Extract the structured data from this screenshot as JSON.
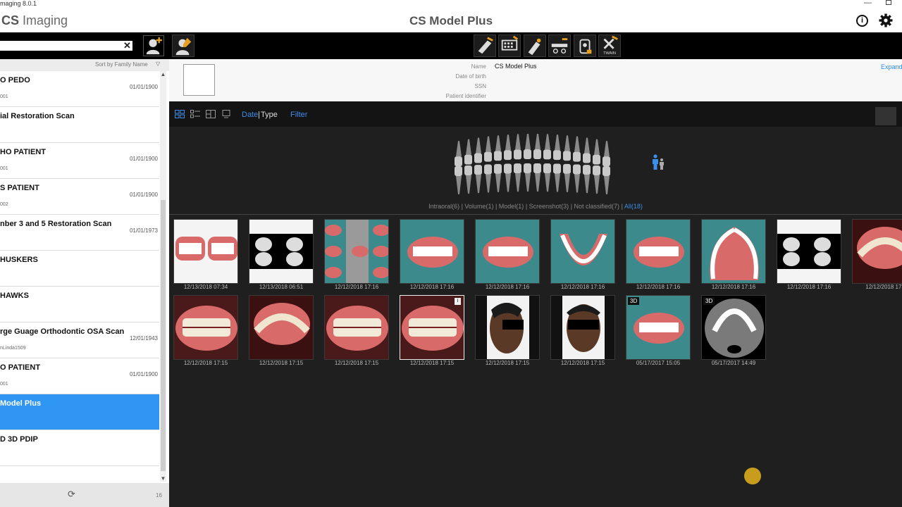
{
  "window": {
    "title": "maging 8.0.1",
    "brand_bold": "CS",
    "brand_rest": " Imaging",
    "app_title": "CS Model Plus"
  },
  "sidebar": {
    "search": {
      "value": "",
      "placeholder": ""
    },
    "sort_label": "Sort by Family Name",
    "patients": [
      {
        "name": "O PEDO",
        "date": "01/01/1900",
        "id": "001"
      },
      {
        "name": "ial Restoration Scan",
        "date": "",
        "id": ""
      },
      {
        "name": "HO PATIENT",
        "date": "01/01/1900",
        "id": "001"
      },
      {
        "name": "S PATIENT",
        "date": "01/01/1900",
        "id": "002"
      },
      {
        "name": "nber 3 and 5 Restoration Scan",
        "date": "01/01/1973",
        "id": ""
      },
      {
        "name": "HUSKERS",
        "date": "",
        "id": ""
      },
      {
        "name": "HAWKS",
        "date": "",
        "id": ""
      },
      {
        "name": "rge Guage Orthodontic OSA Scan",
        "date": "12/01/1943",
        "id": "nLinda1509"
      },
      {
        "name": "O PATIENT",
        "date": "01/01/1900",
        "id": "001"
      },
      {
        "name": "Model Plus",
        "date": "",
        "id": "",
        "selected": true
      },
      {
        "name": "D 3D PDIP",
        "date": "",
        "id": ""
      }
    ],
    "count": "16"
  },
  "toolbar": {
    "twain_label": "TWAIN"
  },
  "patient_info": {
    "name_label": "Name",
    "name_value": "CS Model Plus",
    "dob_label": "Date of birth",
    "ssn_label": "SSN",
    "pid_label": "Patient identifier",
    "expand_label": "Expand"
  },
  "gallery": {
    "date_label": "Date",
    "separator": "|",
    "type_label": "Type",
    "filter_label": "Filter",
    "filters": [
      {
        "label": "Intraoral(6)",
        "active": false
      },
      {
        "label": "Volume(1)",
        "active": false
      },
      {
        "label": "Model(1)",
        "active": false
      },
      {
        "label": "Screenshot(3)",
        "active": false
      },
      {
        "label": "Not classified(7)",
        "active": false
      },
      {
        "label": "All(18)",
        "active": true
      }
    ],
    "row1": [
      {
        "date": "12/13/2018 07:34",
        "kind": "intraoral-pair"
      },
      {
        "date": "12/13/2018 06:51",
        "kind": "tooth-models"
      },
      {
        "date": "12/12/2018 17:16",
        "kind": "model-collage"
      },
      {
        "date": "12/12/2018 17:16",
        "kind": "model-front"
      },
      {
        "date": "12/12/2018 17:16",
        "kind": "model-side"
      },
      {
        "date": "12/12/2018 17:16",
        "kind": "model-arch"
      },
      {
        "date": "12/12/2018 17:16",
        "kind": "model-side"
      },
      {
        "date": "12/12/2018 17:16",
        "kind": "model-palate"
      },
      {
        "date": "12/12/2018 17:16",
        "kind": "tooth-models"
      },
      {
        "date": "12/12/2018 17:",
        "kind": "intraoral-upper"
      }
    ],
    "row2": [
      {
        "date": "12/12/2018 17:15",
        "kind": "intraoral-front"
      },
      {
        "date": "12/12/2018 17:15",
        "kind": "intraoral-upper"
      },
      {
        "date": "12/12/2018 17:15",
        "kind": "intraoral-front"
      },
      {
        "date": "12/12/2018 17:15",
        "kind": "intraoral-front",
        "selected": true,
        "info": "i"
      },
      {
        "date": "12/12/2018 17:15",
        "kind": "face-profile"
      },
      {
        "date": "12/12/2018 17:15",
        "kind": "face-front"
      },
      {
        "date": "05/17/2017 15:05",
        "kind": "model-front",
        "badge": "3D"
      },
      {
        "date": "05/17/2017 14:49",
        "kind": "ct-slice",
        "badge": "3D"
      }
    ]
  },
  "colors": {
    "accent": "#2f96f3",
    "link": "#3b8eea",
    "model_bg": "#3d8a8c",
    "gum": "#d96a6a"
  }
}
